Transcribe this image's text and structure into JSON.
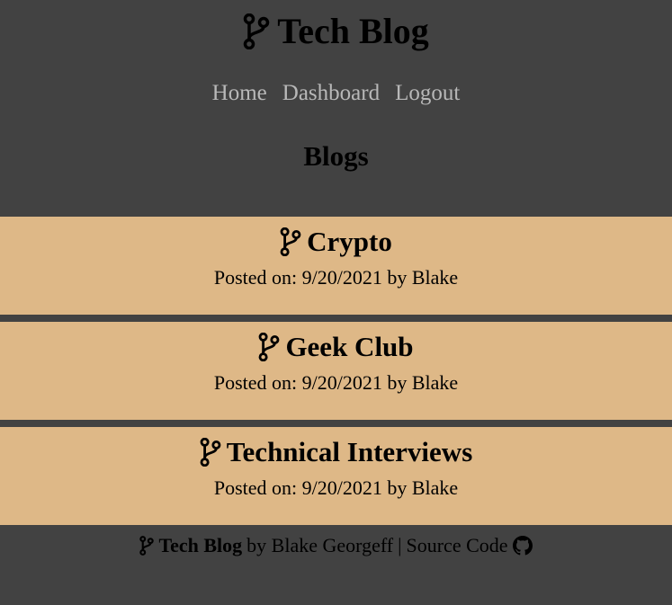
{
  "header": {
    "site_title": "Tech Blog",
    "logo_icon": "code-branch-icon"
  },
  "nav": {
    "items": [
      {
        "label": "Home"
      },
      {
        "label": "Dashboard"
      },
      {
        "label": "Logout"
      }
    ],
    "link_color": "#b8b8b8"
  },
  "page_heading": "Blogs",
  "posts": [
    {
      "title": "Crypto",
      "meta": "Posted on: 9/20/2021 by Blake",
      "icon": "code-branch-icon"
    },
    {
      "title": "Geek Club",
      "meta": "Posted on: 9/20/2021 by Blake",
      "icon": "code-branch-icon"
    },
    {
      "title": "Technical Interviews",
      "meta": "Posted on: 9/20/2021 by Blake",
      "icon": "code-branch-icon"
    }
  ],
  "footer": {
    "brand": "Tech Blog",
    "by_text": "by Blake Georgeff",
    "separator": "|",
    "source_label": "Source Code",
    "source_icon": "github-icon"
  },
  "colors": {
    "background": "#424242",
    "post_card": "#deb887",
    "text": "#000000"
  }
}
